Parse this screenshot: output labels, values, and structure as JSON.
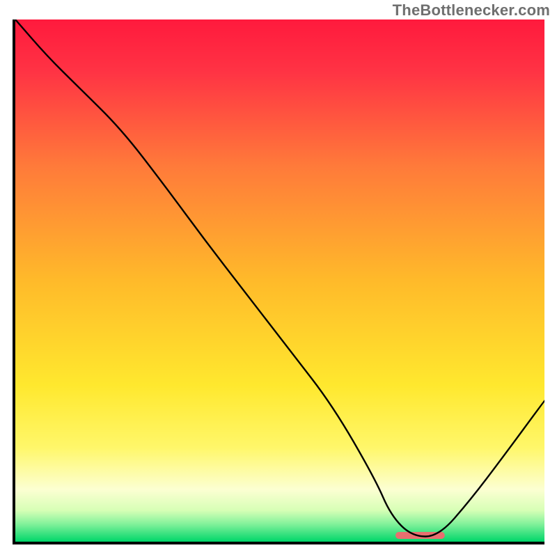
{
  "attribution": "TheBottlenecker.com",
  "chart_data": {
    "type": "line",
    "title": "",
    "xlabel": "",
    "ylabel": "",
    "xlim": [
      0,
      100
    ],
    "ylim": [
      0,
      100
    ],
    "grid": false,
    "background_gradient": {
      "stops": [
        {
          "offset": 0,
          "color": "#ff1a3d"
        },
        {
          "offset": 0.1,
          "color": "#ff3344"
        },
        {
          "offset": 0.28,
          "color": "#ff7a3a"
        },
        {
          "offset": 0.5,
          "color": "#ffba2a"
        },
        {
          "offset": 0.7,
          "color": "#ffe82e"
        },
        {
          "offset": 0.82,
          "color": "#fff76a"
        },
        {
          "offset": 0.9,
          "color": "#fcffd2"
        },
        {
          "offset": 0.94,
          "color": "#d7ffb6"
        },
        {
          "offset": 0.965,
          "color": "#86f29c"
        },
        {
          "offset": 1.0,
          "color": "#00d66a"
        }
      ]
    },
    "series": [
      {
        "name": "bottleneck-curve",
        "color": "#000000",
        "width": 2.4,
        "x": [
          0,
          6,
          12,
          20,
          28,
          36,
          44,
          52,
          60,
          68,
          71,
          75,
          80,
          86,
          92,
          100
        ],
        "y": [
          100,
          93,
          87,
          79,
          68.5,
          57.5,
          47,
          36.5,
          26,
          12,
          5,
          1,
          1,
          8,
          16,
          27
        ]
      }
    ],
    "marker": {
      "name": "optimal-range",
      "x_start": 72.5,
      "x_end": 80.5,
      "y": 1.2,
      "color": "#e76f6f",
      "thickness": 10
    }
  }
}
